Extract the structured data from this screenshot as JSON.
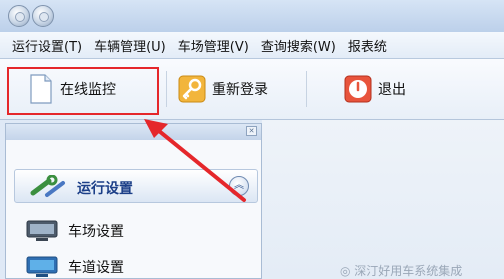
{
  "menubar": {
    "items": [
      "运行设置(T)",
      "车辆管理(U)",
      "车场管理(V)",
      "查询搜索(W)",
      "报表统"
    ]
  },
  "toolbar": {
    "online_monitor": "在线监控",
    "relogin": "重新登录",
    "exit": "退出"
  },
  "panel": {
    "group_title": "运行设置",
    "items": [
      "车场设置",
      "车道设置"
    ]
  },
  "watermark": "◎ 深汀好用车系统集成",
  "colors": {
    "highlight": "#e5272b",
    "group_text": "#1c3f88"
  }
}
